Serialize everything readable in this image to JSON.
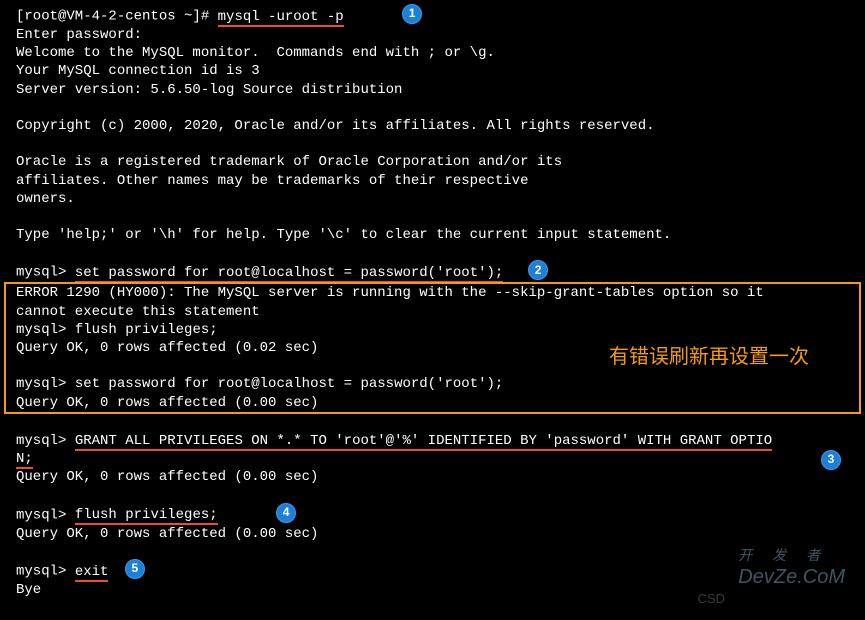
{
  "prompt": {
    "user_host": "[root@VM-4-2-centos ~]#",
    "cmd": "mysql -uroot -p"
  },
  "lines": {
    "enter_pw": "Enter password:",
    "welcome": "Welcome to the MySQL monitor.  Commands end with ; or \\g.",
    "conn_id": "Your MySQL connection id is 3",
    "server_ver": "Server version: 5.6.50-log Source distribution",
    "copyright": "Copyright (c) 2000, 2020, Oracle and/or its affiliates. All rights reserved.",
    "trademark1": "Oracle is a registered trademark of Oracle Corporation and/or its",
    "trademark2": "affiliates. Other names may be trademarks of their respective",
    "trademark3": "owners.",
    "help": "Type 'help;' or '\\h' for help. Type '\\c' to clear the current input statement."
  },
  "mysql_prompt": "mysql>",
  "cmd2": "set password for root@localhost = password('root');",
  "error_line": "ERROR 1290 (HY000): The MySQL server is running with the --skip-grant-tables option so it",
  "error_line2": "cannot execute this statement",
  "flush_cmd": "flush privileges;",
  "query_ok_002": "Query OK, 0 rows affected (0.02 sec)",
  "setpw_again": "set password for root@localhost = password('root');",
  "query_ok_000": "Query OK, 0 rows affected (0.00 sec)",
  "grant_cmd_part1": "GRANT ALL PRIVILEGES ON *.* TO 'root'@'%' IDENTIFIED BY 'password' WITH GRANT OPTIO",
  "grant_cmd_part2": "N;",
  "exit_cmd": "exit",
  "bye": "Bye",
  "annotation": "有错误刷新再设置一次",
  "badges": {
    "b1": "1",
    "b2": "2",
    "b3": "3",
    "b4": "4",
    "b5": "5"
  },
  "watermarks": {
    "devze_top": "开 发 者",
    "devze_bottom": "DevZe.CoM",
    "csdn": "CSD"
  }
}
